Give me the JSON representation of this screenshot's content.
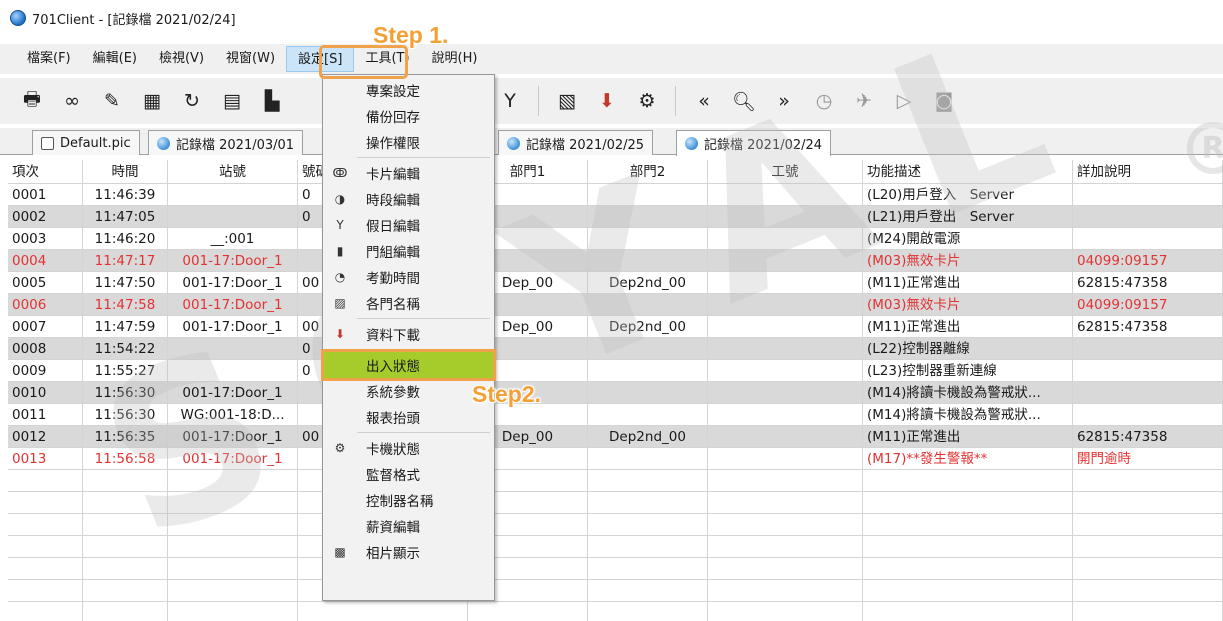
{
  "window": {
    "title": "701Client - [記錄檔 2021/02/24]"
  },
  "menu": [
    {
      "label": "檔案(F)"
    },
    {
      "label": "編輯(E)"
    },
    {
      "label": "檢視(V)"
    },
    {
      "label": "視窗(W)"
    },
    {
      "label": "設定[S]",
      "active": true
    },
    {
      "label": "工具(T)"
    },
    {
      "label": "說明(H)"
    }
  ],
  "toolbar": {
    "icons": [
      "print-icon",
      "link-icon",
      "edit-icon",
      "calendar-icon",
      "refresh-icon",
      "schedule-icon",
      "chart-icon",
      "user-clock-icon",
      "cocktail-icon",
      "image-icon",
      "download-icon",
      "gear-icon",
      "rewind-icon",
      "search-icon",
      "forward-icon",
      "history-icon",
      "pin-icon",
      "play-icon",
      "stop-icon"
    ]
  },
  "tabs": [
    {
      "label": "Default.pic",
      "icon": "document-icon"
    },
    {
      "label": "記錄檔 2021/03/01",
      "icon": "globe-icon"
    },
    {
      "label": "記錄檔 2021/02/25",
      "icon": "globe-icon"
    },
    {
      "label": "記錄檔 2021/02/24",
      "icon": "globe-icon",
      "active": true
    }
  ],
  "grid": {
    "headers": [
      "項次",
      "時間",
      "站號",
      "號碼",
      "部門1",
      "部門2",
      "工號",
      "功能描述",
      "詳加說明"
    ],
    "rows": [
      {
        "cells": [
          "0001",
          "11:46:39",
          "",
          "0",
          "",
          "",
          "",
          "(L20)用戶登入　Server",
          ""
        ],
        "style": ""
      },
      {
        "cells": [
          "0002",
          "11:47:05",
          "",
          "0",
          "",
          "",
          "",
          "(L21)用戶登出　Server",
          ""
        ],
        "style": "grey"
      },
      {
        "cells": [
          "0003",
          "11:46:20",
          "__:001",
          "",
          "",
          "",
          "",
          "(M24)開啟電源",
          ""
        ],
        "style": ""
      },
      {
        "cells": [
          "0004",
          "11:47:17",
          "001-17:Door_1",
          "",
          "",
          "",
          "",
          "(M03)無效卡片",
          "04099:09157"
        ],
        "style": "grey red"
      },
      {
        "cells": [
          "0005",
          "11:47:50",
          "001-17:Door_1",
          "00",
          "Dep_00",
          "Dep2nd_00",
          "",
          "(M11)正常進出",
          "62815:47358"
        ],
        "style": ""
      },
      {
        "cells": [
          "0006",
          "11:47:58",
          "001-17:Door_1",
          "",
          "",
          "",
          "",
          "(M03)無效卡片",
          "04099:09157"
        ],
        "style": "grey red"
      },
      {
        "cells": [
          "0007",
          "11:47:59",
          "001-17:Door_1",
          "00",
          "Dep_00",
          "Dep2nd_00",
          "",
          "(M11)正常進出",
          "62815:47358"
        ],
        "style": ""
      },
      {
        "cells": [
          "0008",
          "11:54:22",
          "",
          "0",
          "",
          "",
          "",
          "(L22)控制器離線",
          ""
        ],
        "style": "grey"
      },
      {
        "cells": [
          "0009",
          "11:55:27",
          "",
          "0",
          "",
          "",
          "",
          "(L23)控制器重新連線",
          ""
        ],
        "style": ""
      },
      {
        "cells": [
          "0010",
          "11:56:30",
          "001-17:Door_1",
          "",
          "",
          "",
          "",
          "(M14)將讀卡機設為警戒狀...",
          ""
        ],
        "style": "grey"
      },
      {
        "cells": [
          "0011",
          "11:56:30",
          "WG:001-18:D...",
          "",
          "",
          "",
          "",
          "(M14)將讀卡機設為警戒狀...",
          ""
        ],
        "style": ""
      },
      {
        "cells": [
          "0012",
          "11:56:35",
          "001-17:Door_1",
          "00",
          "Dep_00",
          "Dep2nd_00",
          "",
          "(M11)正常進出",
          "62815:47358"
        ],
        "style": "grey"
      },
      {
        "cells": [
          "0013",
          "11:56:58",
          "001-17:Door_1",
          "",
          "",
          "",
          "",
          "(M17)**發生警報**",
          "開門逾時"
        ],
        "style": "red"
      }
    ]
  },
  "dropdown": {
    "items": [
      {
        "label": "專案設定",
        "icon": ""
      },
      {
        "label": "備份回存",
        "icon": ""
      },
      {
        "label": "操作權限",
        "icon": "",
        "sep_after": true
      },
      {
        "label": "卡片編輯",
        "icon": "card-icon"
      },
      {
        "label": "時段編輯",
        "icon": "clock-icon"
      },
      {
        "label": "假日編輯",
        "icon": "cocktail-icon"
      },
      {
        "label": "門組編輯",
        "icon": "door-icon"
      },
      {
        "label": "考勤時間",
        "icon": "attendance-icon"
      },
      {
        "label": "各門名稱",
        "icon": "name-icon",
        "sep_after": true
      },
      {
        "label": "資料下載",
        "icon": "download-icon",
        "sep_after": true
      },
      {
        "label": "出入狀態",
        "icon": "",
        "highlight": true
      },
      {
        "label": "系統參數",
        "icon": ""
      },
      {
        "label": "報表抬頭",
        "icon": "",
        "sep_after": true
      },
      {
        "label": "卡機狀態",
        "icon": "gear-icon"
      },
      {
        "label": "監督格式",
        "icon": ""
      },
      {
        "label": "控制器名稱",
        "icon": ""
      },
      {
        "label": "薪資編輯",
        "icon": ""
      },
      {
        "label": "相片顯示",
        "icon": "photo-icon"
      }
    ]
  },
  "annotations": {
    "step1": "Step 1.",
    "step2": "Step2."
  },
  "watermark": {
    "text": "SOYAL",
    "mark": "R"
  },
  "colors": {
    "accent_orange": "#f0a24a",
    "highlight_green": "#a5cc2b",
    "error_red": "#e23333",
    "row_grey": "#d9d9d9"
  }
}
